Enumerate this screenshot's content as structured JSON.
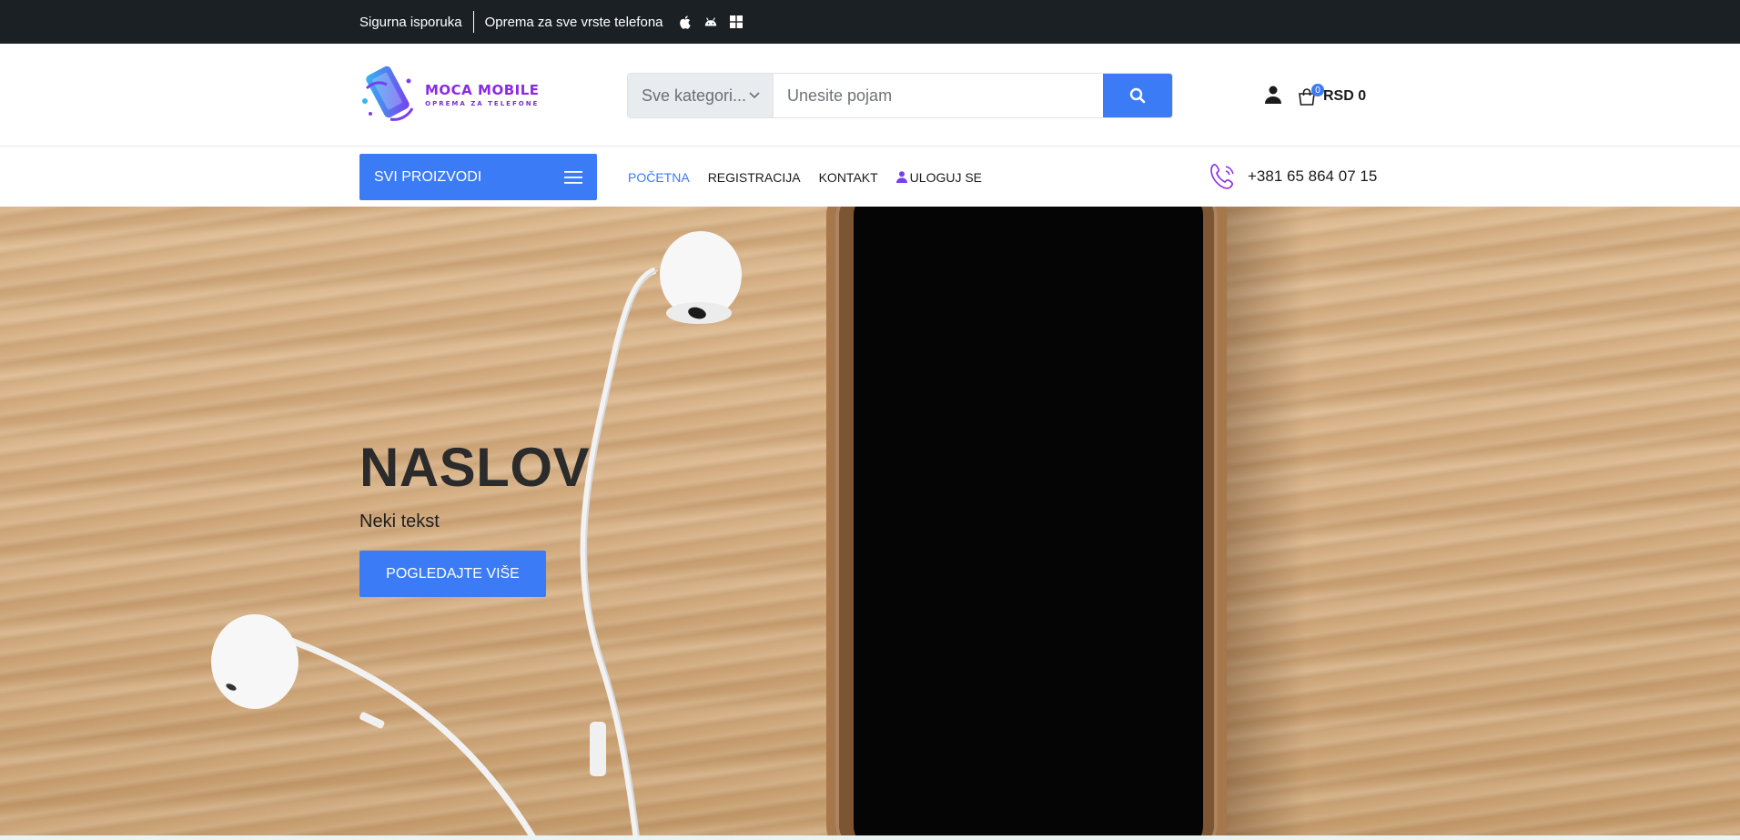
{
  "topbar": {
    "delivery": "Sigurna isporuka",
    "equipment": "Oprema za sve vrste telefona",
    "icons": [
      "apple-icon",
      "android-icon",
      "windows-icon"
    ]
  },
  "header": {
    "logo_title": "MOCA MOBILE",
    "logo_subtitle": "OPREMA ZA TELEFONE",
    "search": {
      "category": "Sve kategori...",
      "placeholder": "Unesite pojam"
    },
    "cart": {
      "count": "0",
      "total": "RSD 0"
    }
  },
  "nav": {
    "all_products": "SVI PROIZVODI",
    "menu": [
      "POČETNA",
      "REGISTRACIJA",
      "KONTAKT",
      "ULOGUJ SE"
    ],
    "phone": "+381 65 864 07 15"
  },
  "hero": {
    "title": "NASLOV",
    "subtitle": "Neki tekst",
    "button": "POGLEDAJTE VIŠE"
  },
  "colors": {
    "accent": "#3b7bf6",
    "topbar": "#1b2025",
    "brand": "#8a2be2"
  }
}
